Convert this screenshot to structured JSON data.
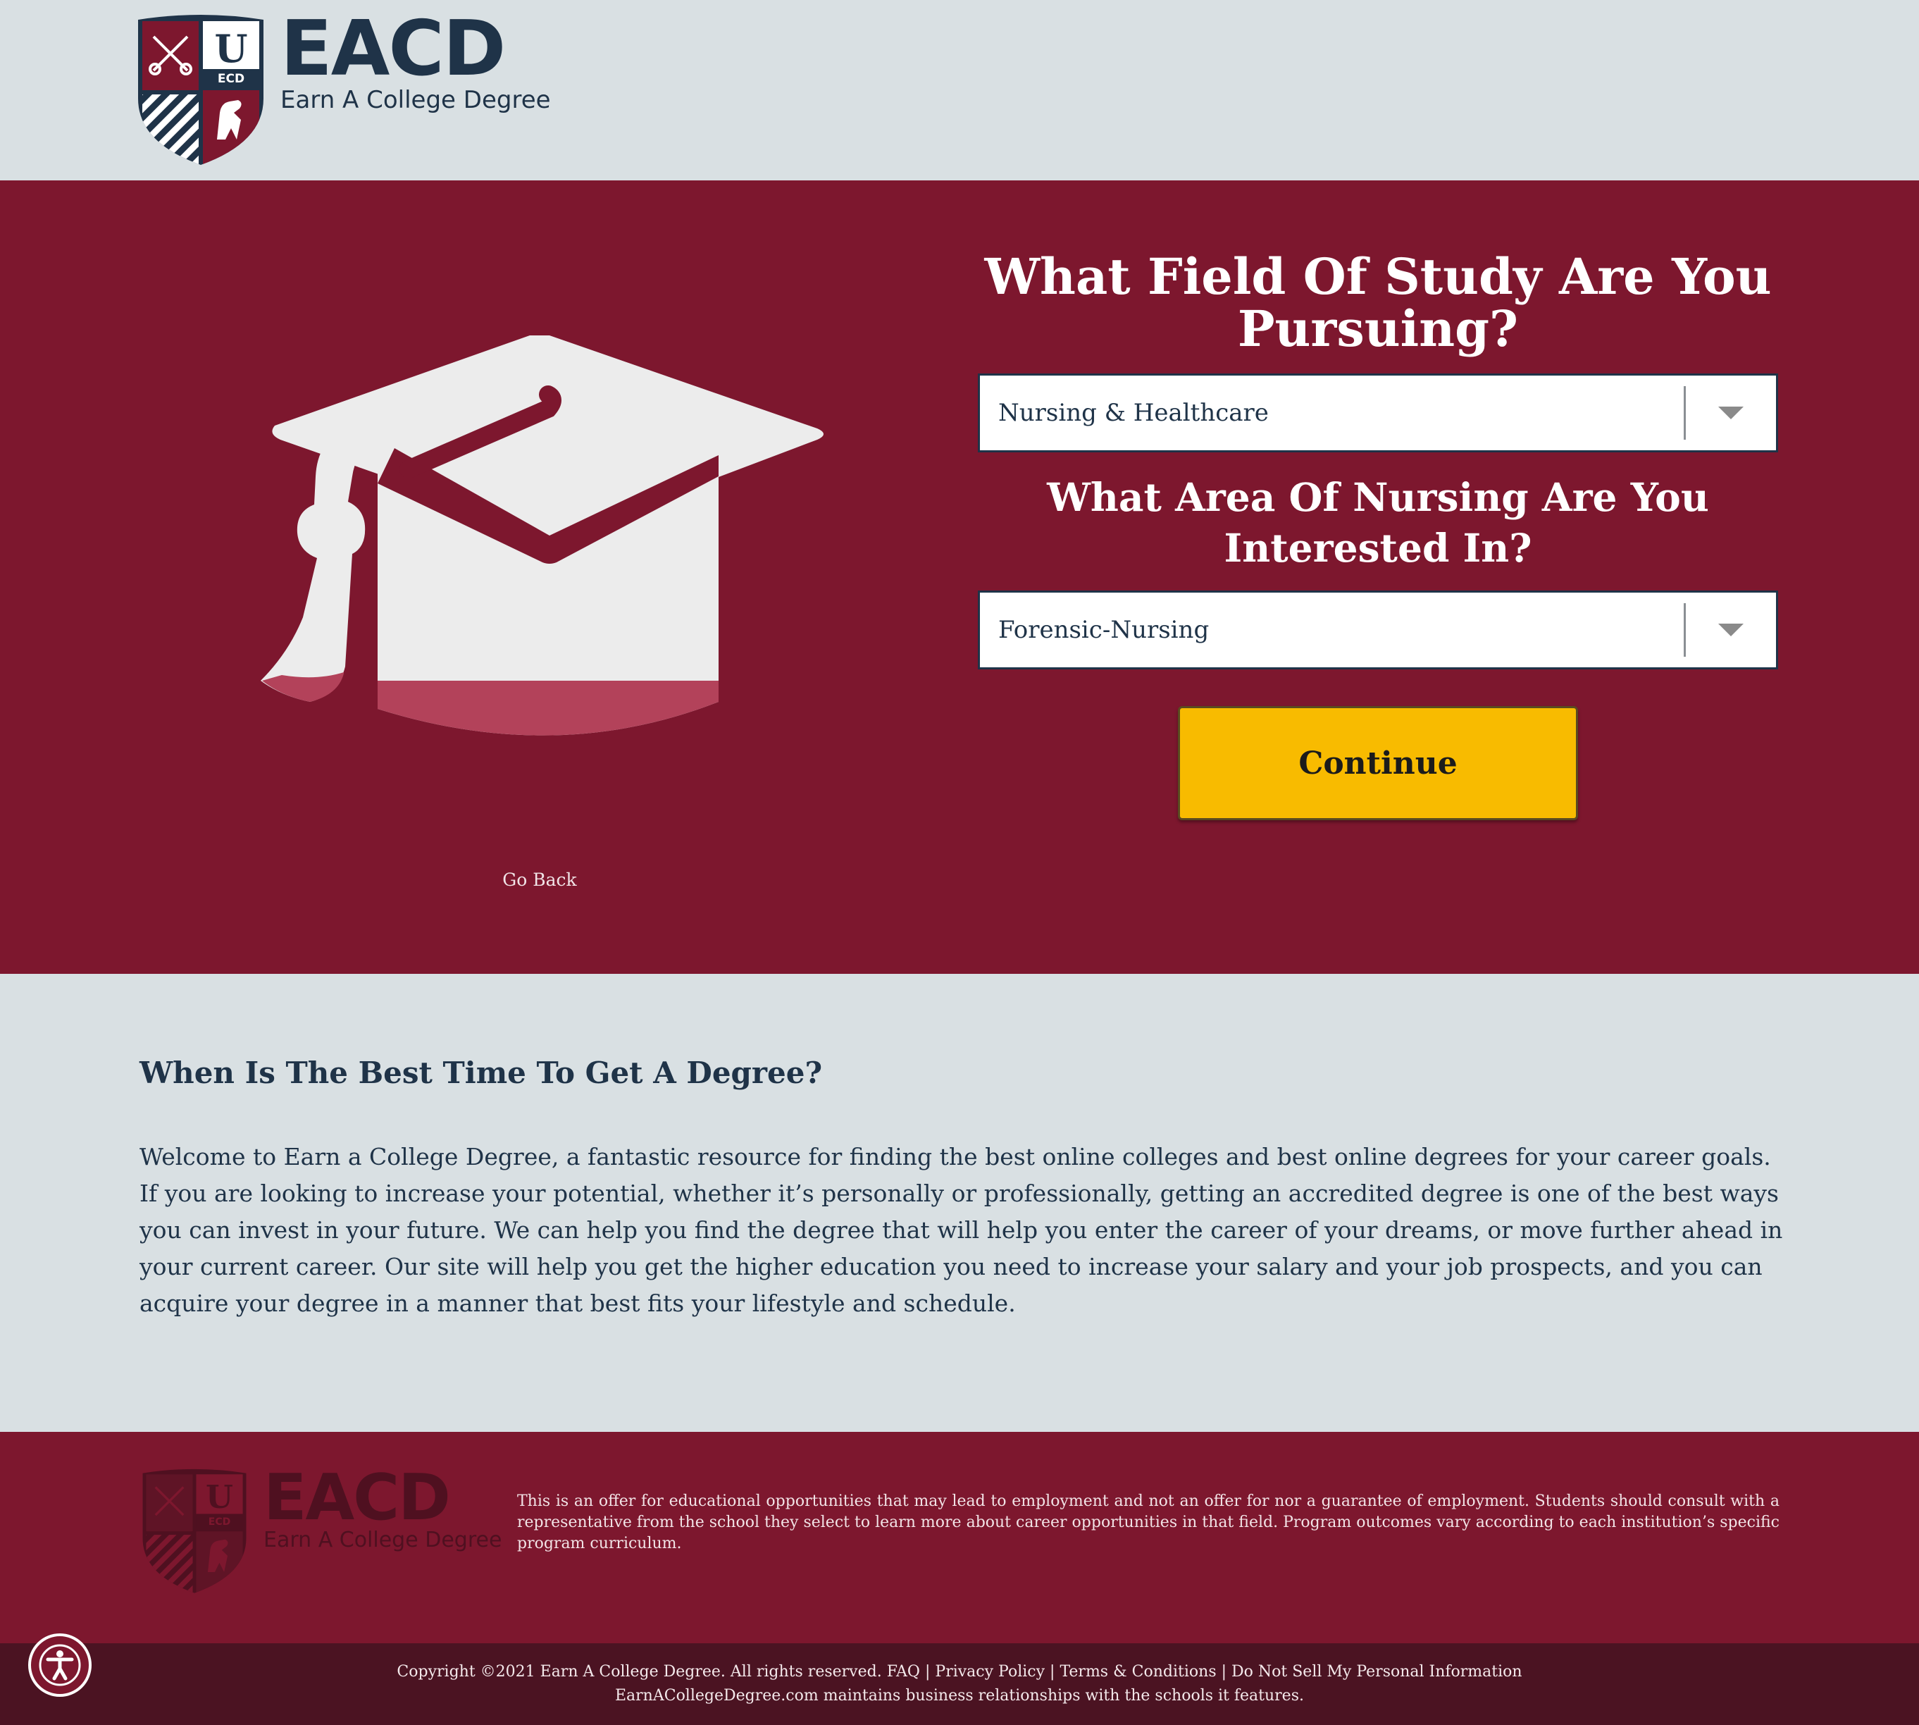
{
  "header": {
    "logo_abbr": "EACD",
    "logo_name": "Earn A College Degree",
    "shield_letter": "U",
    "shield_band": "ECD"
  },
  "hero": {
    "question_1": "What Field Of Study Are You Pursuing?",
    "select_1_value": "Nursing & Healthcare",
    "question_2": "What Area Of Nursing Are You Interested In?",
    "select_2_value": "Forensic-Nursing",
    "continue_label": "Continue",
    "go_back_label": "Go Back"
  },
  "content": {
    "heading": "When Is The Best Time To Get A Degree?",
    "body": "Welcome to Earn a College Degree, a fantastic resource for finding the best online colleges and best online degrees for your career goals. If you are looking to increase your potential, whether it’s personally or professionally, getting an accredited degree is one of the best ways you can invest in your future. We can help you find the degree that will help you enter the career of your dreams, or move further ahead in your current career. Our site will help you get the higher education you need to increase your salary and your job prospects, and you can acquire your degree in a manner that best fits your lifestyle and schedule."
  },
  "footer": {
    "logo_abbr": "EACD",
    "logo_name": "Earn A College Degree",
    "disclaimer": "This is an offer for educational opportunities that may lead to employment and not an offer for nor a guarantee of employment. Students should consult with a representative from the school they select to learn more about career opportunities in that field. Program outcomes vary according to each institution’s specific program curriculum.",
    "copyright": "Copyright ©2021 Earn A College Degree. All rights reserved.",
    "links": {
      "faq": "FAQ",
      "privacy": "Privacy Policy",
      "terms": "Terms & Conditions",
      "do_not_sell": "Do Not Sell My Personal Information"
    },
    "separator": "|",
    "relationship_note": "EarnACollegeDegree.com maintains business relationships with the schools it features."
  },
  "colors": {
    "primary_maroon": "#7d172e",
    "dark_maroon": "#4b1322",
    "navy": "#1f3348",
    "light_gray": "#d9e0e3",
    "continue_yellow": "#f8bb00"
  },
  "icons": {
    "hero_illustration": "graduation-cap-icon",
    "select_arrow": "chevron-down-icon",
    "accessibility": "accessibility-icon"
  }
}
